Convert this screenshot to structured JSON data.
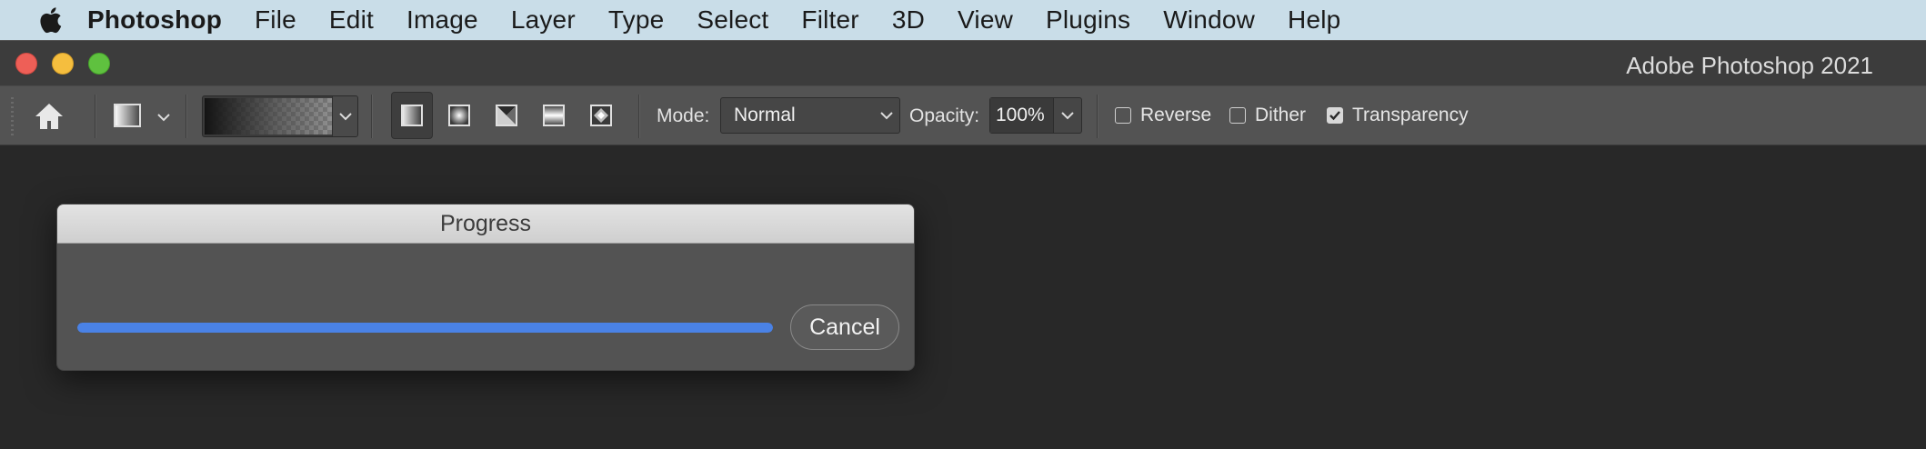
{
  "menubar": {
    "apple_icon": "apple-logo-icon",
    "items": [
      "Photoshop",
      "File",
      "Edit",
      "Image",
      "Layer",
      "Type",
      "Select",
      "Filter",
      "3D",
      "View",
      "Plugins",
      "Window",
      "Help"
    ]
  },
  "window": {
    "title": "Adobe Photoshop 2021",
    "traffic_colors": {
      "close": "#ee5f57",
      "minimize": "#f5be3e",
      "maximize": "#5fc13f"
    }
  },
  "options_bar": {
    "home_icon": "home-icon",
    "tool_preset_icon": "gradient-tool-preset-icon",
    "gradient_types": [
      "linear",
      "radial",
      "angle",
      "reflected",
      "diamond"
    ],
    "selected_gradient_type": "linear",
    "mode_label": "Mode:",
    "mode_value": "Normal",
    "opacity_label": "Opacity:",
    "opacity_value": "100%",
    "reverse_label": "Reverse",
    "reverse_checked": false,
    "dither_label": "Dither",
    "dither_checked": false,
    "transparency_label": "Transparency",
    "transparency_checked": true
  },
  "dialog": {
    "title": "Progress",
    "progress_percent": 100,
    "progress_color": "#4a82e6",
    "cancel_label": "Cancel"
  }
}
